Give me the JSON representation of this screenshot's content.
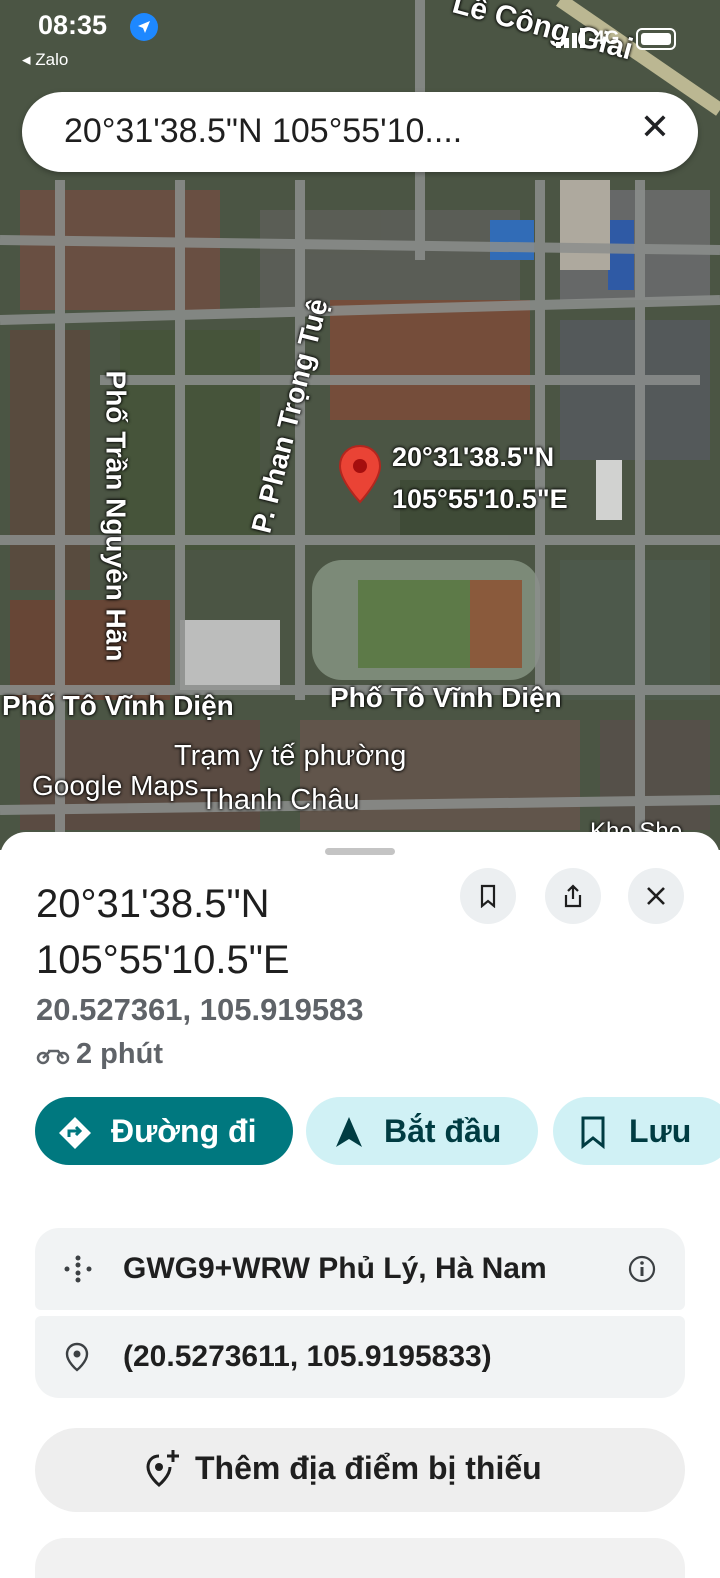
{
  "status_bar": {
    "time": "08:35",
    "back_app": "Zalo",
    "network": "4G"
  },
  "search": {
    "query": "20°31'38.5\"N 105°55'10....",
    "close_icon": "close-icon"
  },
  "map": {
    "labels": {
      "road_top": "Lê Công Giai",
      "phan_trong_tue": "P. Phan Trọng Tuệ",
      "tran_nguyen_han": "Phố Trần Nguyên Hãn",
      "pin_lat": "20°31'38.5\"N",
      "pin_lng": "105°55'10.5\"E",
      "to_vinh_dien_left": "Phố Tô Vĩnh Diện",
      "to_vinh_dien_right": "Phố Tô Vĩnh Diện",
      "clinic_line1": "Trạm y tế phường",
      "clinic_line2": "Thanh Châu",
      "watermark": "Google Maps",
      "corner": "Kho Sho"
    }
  },
  "place": {
    "title_line1": "20°31'38.5\"N",
    "title_line2": "105°55'10.5\"E",
    "decimal": "20.527361, 105.919583",
    "eta": "2 phút"
  },
  "actions": {
    "directions": "Đường đi",
    "start": "Bắt đầu",
    "save": "Lưu"
  },
  "details": {
    "plus_code": "GWG9+WRW Phủ Lý, Hà Nam",
    "coordinates": "(20.5273611, 105.9195833)",
    "add_missing": "Thêm địa điểm bị thiếu"
  },
  "colors": {
    "primary": "#00787f",
    "tonal": "#d0f1f5",
    "pin": "#ea4335"
  }
}
